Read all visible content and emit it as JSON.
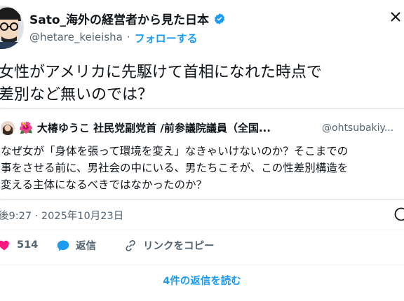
{
  "author": {
    "name": "Sato_海外の経営者から見た日本",
    "handle": "@hetare_keieisha",
    "separator": "·",
    "follow_label": "フォローする"
  },
  "tweet": {
    "text": "女性がアメリカに先駆けて首相になれた時点で\n差別など無いのでは？"
  },
  "quoted": {
    "name": "大椿ゆうこ 社民党副党首 /前参議院議員（全国...",
    "handle": "@ohtsubakiy...",
    "text": "なぜ女が「身体を張って環境を変え」なきゃいけないのか？そこまでの\n事をさせる前に、男社会の中にいる、男たちこそが、この性差別構造を\n変える主体になるべきではなかったのか？"
  },
  "meta": {
    "timestamp": "後9:27 · 2025年10月23日"
  },
  "actions": {
    "like_count": "514",
    "reply_label": "返信",
    "copy_link_label": "リンクをコピー"
  },
  "replies": {
    "read_label": "4件の返信を読む"
  },
  "colors": {
    "accent": "#1d9bf0",
    "like": "#f91880",
    "muted": "#536471"
  }
}
